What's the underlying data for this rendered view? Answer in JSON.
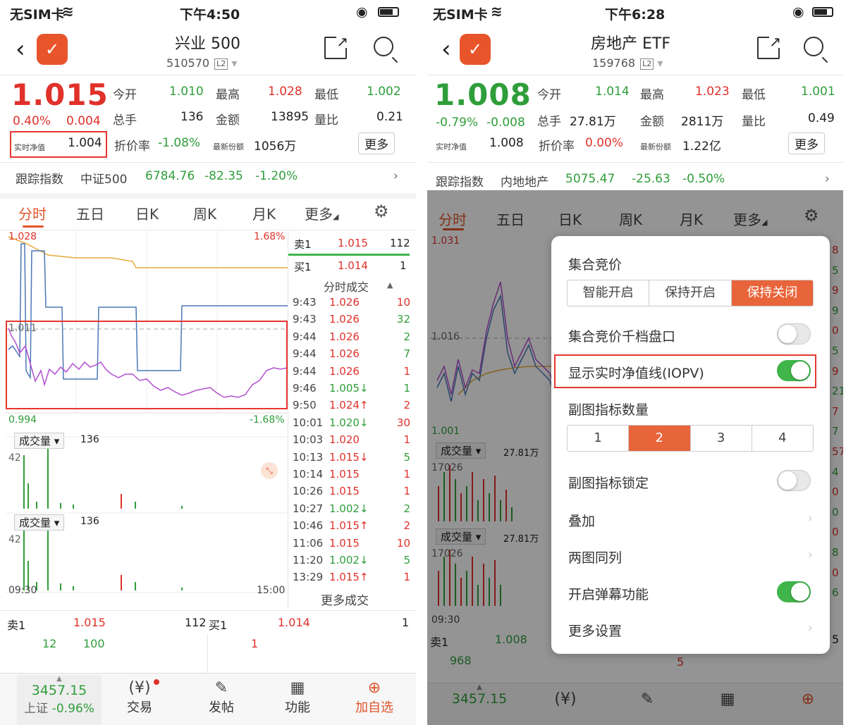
{
  "left": {
    "status": {
      "carrier": "无SIM卡",
      "time": "下午4:50"
    },
    "header": {
      "title": "兴业 500",
      "code": "510570",
      "badge": "L2"
    },
    "quote": {
      "price": "1.015",
      "pct": "0.40%",
      "chg": "0.004",
      "open_label": "今开",
      "open": "1.010",
      "high_label": "最高",
      "high": "1.028",
      "low_label": "最低",
      "low": "1.002",
      "vol_label": "总手",
      "vol": "136",
      "amt_label": "金额",
      "amt": "13895",
      "ratio_label": "量比",
      "ratio": "0.21",
      "iopv_label": "实时净值",
      "iopv": "1.004",
      "disc_label": "折价率",
      "disc": "-1.08%",
      "shares_label": "最新份额",
      "shares": "1056万",
      "more": "更多"
    },
    "track": {
      "label": "跟踪指数",
      "name": "中证500",
      "value": "6784.76",
      "chg": "-82.35",
      "pct": "-1.20%"
    },
    "tabs": [
      "分时",
      "五日",
      "日K",
      "周K",
      "月K",
      "更多"
    ],
    "chart": {
      "ymax": "1.028",
      "ymaxpct": "1.68%",
      "ymid": "1.011",
      "ymin": "0.994",
      "yminpct": "-1.68%",
      "vol1_label": "成交量",
      "vol1_val": "136",
      "vol1_max": "42",
      "vol2_label": "成交量",
      "vol2_val": "136",
      "vol2_max": "42",
      "t_start": "09:30",
      "t_end": "15:00"
    },
    "book": {
      "sell": "卖1",
      "sell_price": "1.015",
      "sell_qty": "112",
      "buy": "买1",
      "buy_price": "1.014",
      "buy_qty": "1",
      "ticks_title": "分时成交",
      "more_trades": "更多成交"
    },
    "ticks": [
      {
        "t": "9:43",
        "p": "1.026",
        "q": "10",
        "c": "red",
        "qc": "red"
      },
      {
        "t": "9:43",
        "p": "1.026",
        "q": "32",
        "c": "red",
        "qc": "green"
      },
      {
        "t": "9:44",
        "p": "1.026",
        "q": "2",
        "c": "red",
        "qc": "green"
      },
      {
        "t": "9:44",
        "p": "1.026",
        "q": "7",
        "c": "red",
        "qc": "green"
      },
      {
        "t": "9:44",
        "p": "1.026",
        "q": "1",
        "c": "red",
        "qc": "red"
      },
      {
        "t": "9:46",
        "p": "1.005↓",
        "q": "1",
        "c": "green",
        "qc": "green"
      },
      {
        "t": "9:50",
        "p": "1.024↑",
        "q": "2",
        "c": "red",
        "qc": "red"
      },
      {
        "t": "10:01",
        "p": "1.020↓",
        "q": "30",
        "c": "green",
        "qc": "red"
      },
      {
        "t": "10:03",
        "p": "1.020",
        "q": "1",
        "c": "red",
        "qc": "red"
      },
      {
        "t": "10:13",
        "p": "1.015↓",
        "q": "5",
        "c": "red",
        "qc": "green"
      },
      {
        "t": "10:14",
        "p": "1.015",
        "q": "1",
        "c": "red",
        "qc": "red"
      },
      {
        "t": "10:26",
        "p": "1.015",
        "q": "1",
        "c": "red",
        "qc": "red"
      },
      {
        "t": "10:27",
        "p": "1.002↓",
        "q": "2",
        "c": "green",
        "qc": "green"
      },
      {
        "t": "10:46",
        "p": "1.015↑",
        "q": "2",
        "c": "red",
        "qc": "red"
      },
      {
        "t": "11:06",
        "p": "1.015",
        "q": "10",
        "c": "red",
        "qc": "red"
      },
      {
        "t": "11:20",
        "p": "1.002↓",
        "q": "5",
        "c": "green",
        "qc": "green"
      },
      {
        "t": "13:29",
        "p": "1.015↑",
        "q": "1",
        "c": "red",
        "qc": "red"
      }
    ],
    "bottom_book": {
      "sell": "卖1",
      "sell_price": "1.015",
      "sell_qty": "112",
      "buy": "买1",
      "buy_price": "1.014",
      "buy_qty": "1",
      "a": "12",
      "b": "100",
      "c": "1"
    },
    "bottom": {
      "index_value": "3457.15",
      "index_name": "上证",
      "index_pct": "-0.96%",
      "trade": "交易",
      "post": "发帖",
      "func": "功能",
      "add": "加自选"
    }
  },
  "right": {
    "status": {
      "carrier": "无SIM卡",
      "time": "下午6:28"
    },
    "header": {
      "title": "房地产 ETF",
      "code": "159768",
      "badge": "L2"
    },
    "quote": {
      "price": "1.008",
      "pct": "-0.79%",
      "chg": "-0.008",
      "open_label": "今开",
      "open": "1.014",
      "high_label": "最高",
      "high": "1.023",
      "low_label": "最低",
      "low": "1.001",
      "vol_label": "总手",
      "vol": "27.81万",
      "amt_label": "金额",
      "amt": "2811万",
      "ratio_label": "量比",
      "ratio": "0.49",
      "iopv_label": "实时净值",
      "iopv": "1.008",
      "disc_label": "折价率",
      "disc": "0.00%",
      "shares_label": "最新份额",
      "shares": "1.22亿",
      "more": "更多"
    },
    "track": {
      "label": "跟踪指数",
      "name": "内地地产",
      "value": "5075.47",
      "chg": "-25.63",
      "pct": "-0.50%"
    },
    "tabs": [
      "分时",
      "五日",
      "日K",
      "周K",
      "月K",
      "更多"
    ],
    "chart": {
      "ymax": "1.031",
      "ymid": "1.016",
      "ymin": "1.001",
      "vol1_label": "成交量",
      "vol1_val": "27.81万",
      "vol1_max": "17026",
      "vol2_label": "成交量",
      "vol2_val": "27.81万",
      "vol2_max": "17026",
      "t_start": "09:30"
    },
    "edge": [
      "8",
      "5",
      "9",
      "9",
      "0",
      "5",
      "9",
      "21",
      "7",
      "7",
      "57",
      "4",
      "0",
      "0",
      "0",
      "8",
      "0",
      "6"
    ],
    "book": {
      "sell": "卖1",
      "sell_price": "1.008",
      "right_qty": "5",
      "a": "968",
      "b": "5"
    },
    "bottom": {
      "index_value": "3457.15"
    },
    "panel": {
      "auction_title": "集合竞价",
      "auction_opts": [
        "智能开启",
        "保持开启",
        "保持关闭"
      ],
      "depth": "集合竞价千档盘口",
      "iopv": "显示实时净值线(IOPV)",
      "sub_count": "副图指标数量",
      "sub_opts": [
        "1",
        "2",
        "3",
        "4"
      ],
      "sub_lock": "副图指标锁定",
      "overlay": "叠加",
      "dual": "两图同列",
      "danmaku": "开启弹幕功能",
      "more": "更多设置"
    }
  }
}
